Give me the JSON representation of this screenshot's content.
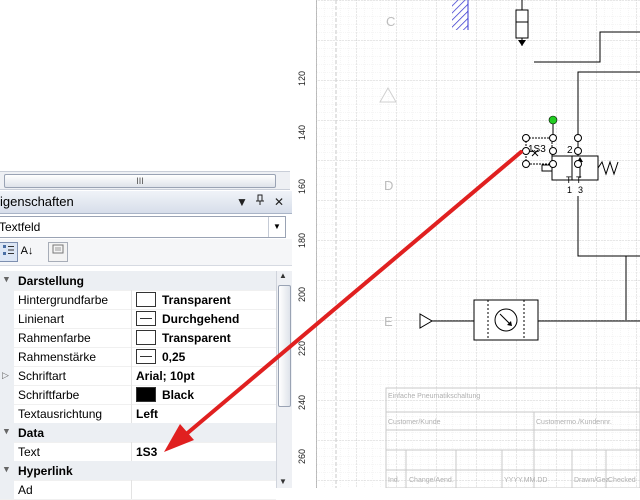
{
  "panel": {
    "title": "igenschaften",
    "dropdown_icon": "dropdown-arrow-icon",
    "pin_icon": "pin-icon",
    "close_icon": "close-icon"
  },
  "scrollbar": {
    "grip": "III"
  },
  "object_select": {
    "value": "Textfeld"
  },
  "toolbar": {
    "categorized_icon": "categorized-icon",
    "alpha_icon": "alphabetical-sort-icon",
    "pages_icon": "property-pages-icon",
    "alpha_label": "A↓"
  },
  "properties": [
    {
      "type": "category",
      "label": "Darstellung"
    },
    {
      "type": "prop",
      "name": "Hintergrundfarbe",
      "value": "Transparent",
      "swatch": "white"
    },
    {
      "type": "prop",
      "name": "Linienart",
      "value": "Durchgehend",
      "swatch": "line"
    },
    {
      "type": "prop",
      "name": "Rahmenfarbe",
      "value": "Transparent",
      "swatch": "white"
    },
    {
      "type": "prop",
      "name": "Rahmenstärke",
      "value": "0,25",
      "swatch": "line"
    },
    {
      "type": "prop",
      "name": "Schriftart",
      "value": "Arial; 10pt",
      "swatch": "none",
      "expandable": true
    },
    {
      "type": "prop",
      "name": "Schriftfarbe",
      "value": "Black",
      "swatch": "black"
    },
    {
      "type": "prop",
      "name": "Textausrichtung",
      "value": "Left",
      "swatch": "none"
    },
    {
      "type": "category",
      "label": "Data"
    },
    {
      "type": "prop",
      "name": "Text",
      "value": "1S3",
      "swatch": "none"
    },
    {
      "type": "category",
      "label": "Hyperlink"
    },
    {
      "type": "prop",
      "name": "Ad",
      "value": "",
      "swatch": "none"
    }
  ],
  "ruler": {
    "ticks": [
      "120",
      "140",
      "160",
      "180",
      "200",
      "220",
      "240",
      "260"
    ]
  },
  "drawing": {
    "zone_letters": [
      "C",
      "D",
      "E"
    ],
    "component_label": "1S3",
    "port_labels": [
      "2",
      "T",
      "T",
      "1",
      "3"
    ],
    "title_block": {
      "title": "Einfache Pneumatikschaltung",
      "customer": "Customer/Kunde",
      "customer_memo": "Customermo./Kundennr.",
      "footer": [
        "Ind.",
        "Change/Aend.",
        "YYYY.MM.DD",
        "Drawn/Gez.",
        "Checked"
      ]
    },
    "arrow_color": "#e02020",
    "selection_handle_color": "#22cc22"
  }
}
